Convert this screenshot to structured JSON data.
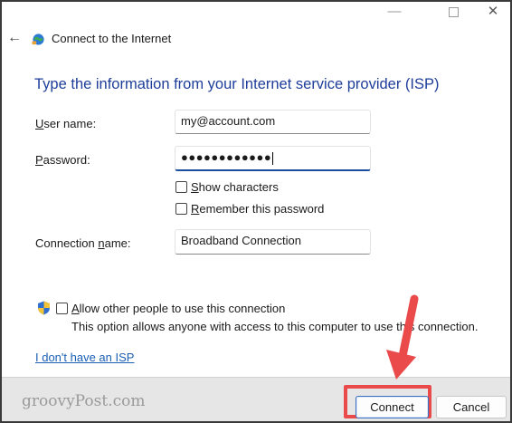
{
  "window": {
    "title": "Connect to the Internet",
    "controls": {
      "minimize": "—",
      "close": "✕"
    },
    "back": "←"
  },
  "heading": "Type the information from your Internet service provider (ISP)",
  "form": {
    "user_name": {
      "label_key": "U",
      "label_rest": "ser name:",
      "value": "my@account.com"
    },
    "password": {
      "label_key": "P",
      "label_rest": "assword:",
      "value": "●●●●●●●●●●●●"
    },
    "show_characters": {
      "key": "S",
      "rest": "how characters",
      "checked": false
    },
    "remember_password": {
      "key": "R",
      "rest": "emember this password",
      "checked": false
    },
    "connection_name": {
      "label_pre": "Connection ",
      "label_key": "n",
      "label_rest": "ame:",
      "value": "Broadband Connection"
    }
  },
  "allow_others": {
    "key": "A",
    "rest": "llow other people to use this connection",
    "checked": false,
    "note": "This option allows anyone with access to this computer to use this connection."
  },
  "no_isp_link": "I don't have an ISP",
  "footer": {
    "watermark": "groovyPost.com",
    "connect_label": "Connect",
    "cancel_label": "Cancel"
  },
  "colors": {
    "heading": "#1e3e9a",
    "link": "#1a5fb4",
    "annotation": "#ea4a4a",
    "focus": "#1a4f9e"
  }
}
